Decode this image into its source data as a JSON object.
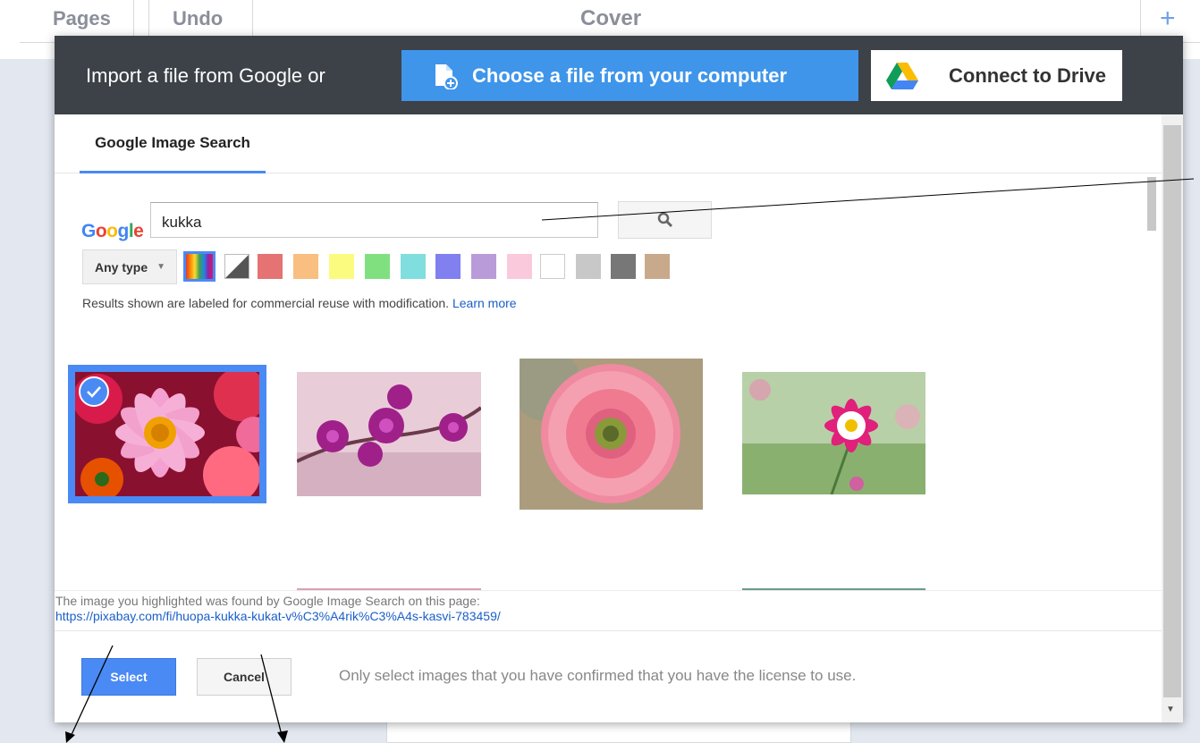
{
  "topbar": {
    "pages_label": "Pages",
    "undo_label": "Undo",
    "title": "Cover",
    "add_label": "+"
  },
  "header": {
    "import_text": "Import a file from Google or",
    "computer_button": "Choose a file from your computer",
    "drive_button": "Connect to Drive"
  },
  "tabs": [
    {
      "label": "Google Image Search"
    }
  ],
  "search": {
    "logo": "Google",
    "value": "kukka",
    "type_filter": "Any type"
  },
  "color_filters": [
    {
      "name": "full-color",
      "color": "rainbow",
      "selected": true
    },
    {
      "name": "black-and-white",
      "color": "#555555"
    },
    {
      "name": "red",
      "color": "#e57373"
    },
    {
      "name": "orange",
      "color": "#f9bf80"
    },
    {
      "name": "yellow",
      "color": "#fbfb80"
    },
    {
      "name": "green",
      "color": "#80e080"
    },
    {
      "name": "teal",
      "color": "#80dede"
    },
    {
      "name": "blue",
      "color": "#8080f0"
    },
    {
      "name": "purple",
      "color": "#b99bd9"
    },
    {
      "name": "pink",
      "color": "#fbc9dc"
    },
    {
      "name": "white",
      "color": "#ffffff"
    },
    {
      "name": "gray",
      "color": "#c8c8c8"
    },
    {
      "name": "black",
      "color": "#777777"
    },
    {
      "name": "brown",
      "color": "#c9a98b"
    }
  ],
  "notice": {
    "text": "Results shown are labeled for commercial reuse with modification.",
    "link": "Learn more"
  },
  "results": [
    {
      "name": "pink-daisy-bouquet",
      "selected": true
    },
    {
      "name": "purple-orchids",
      "selected": false
    },
    {
      "name": "pink-gerbera",
      "selected": false
    },
    {
      "name": "pink-cosmos",
      "selected": false
    }
  ],
  "footer": {
    "info_text": "The image you highlighted was found by Google Image Search on this page:",
    "source_url": "https://pixabay.com/fi/huopa-kukka-kukat-v%C3%A4rik%C3%A4s-kasvi-783459/"
  },
  "actions": {
    "select_label": "Select",
    "cancel_label": "Cancel",
    "note": "Only select images that you have confirmed that you have the license to use."
  },
  "colors": {
    "header_bg": "#3d4148",
    "accent_blue": "#3f95ea",
    "select_blue": "#4a8af4",
    "app_bg": "#e3e8f0"
  }
}
